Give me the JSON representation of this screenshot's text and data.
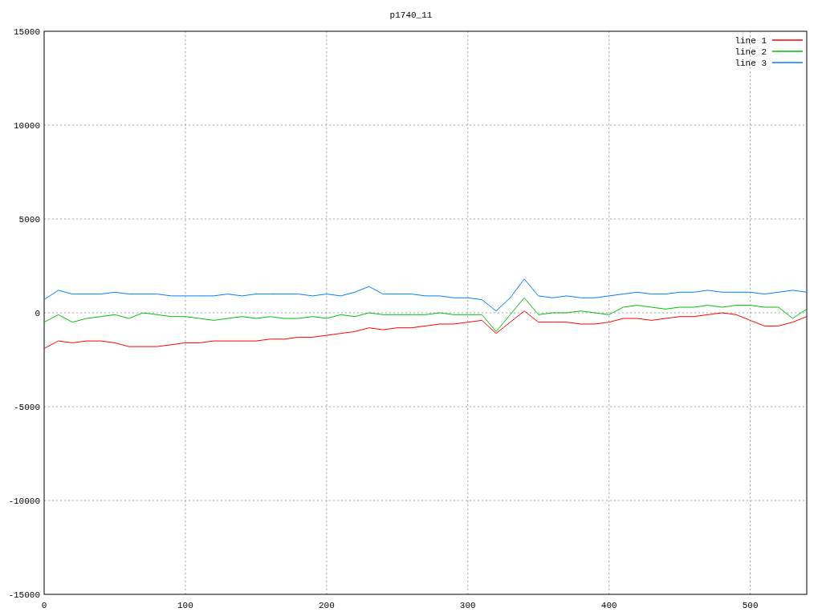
{
  "chart_data": {
    "type": "line",
    "title": "p1740_11",
    "x": [
      0,
      10,
      20,
      30,
      40,
      50,
      60,
      70,
      80,
      90,
      100,
      110,
      120,
      130,
      140,
      150,
      160,
      170,
      180,
      190,
      200,
      210,
      220,
      230,
      240,
      250,
      260,
      270,
      280,
      290,
      300,
      310,
      320,
      330,
      340,
      350,
      360,
      370,
      380,
      390,
      400,
      410,
      420,
      430,
      440,
      450,
      460,
      470,
      480,
      490,
      500,
      510,
      520,
      530,
      540
    ],
    "series": [
      {
        "name": "line 1",
        "color": "#ff0000",
        "values": [
          -1900,
          -1500,
          -1600,
          -1500,
          -1500,
          -1600,
          -1800,
          -1800,
          -1800,
          -1700,
          -1600,
          -1600,
          -1500,
          -1500,
          -1500,
          -1500,
          -1400,
          -1400,
          -1300,
          -1300,
          -1200,
          -1100,
          -1000,
          -800,
          -900,
          -800,
          -800,
          -700,
          -600,
          -600,
          -500,
          -400,
          -1100,
          -500,
          100,
          -500,
          -500,
          -500,
          -600,
          -600,
          -500,
          -300,
          -300,
          -400,
          -300,
          -200,
          -200,
          -100,
          0,
          -100,
          -400,
          -700,
          -700,
          -500,
          -200
        ]
      },
      {
        "name": "line 2",
        "color": "#00c000",
        "values": [
          -500,
          -100,
          -500,
          -300,
          -200,
          -100,
          -300,
          0,
          -100,
          -200,
          -200,
          -300,
          -400,
          -300,
          -200,
          -300,
          -200,
          -300,
          -300,
          -200,
          -300,
          -100,
          -200,
          0,
          -100,
          -100,
          -100,
          -100,
          0,
          -100,
          -100,
          -100,
          -1000,
          -100,
          800,
          -100,
          0,
          0,
          100,
          0,
          -100,
          300,
          400,
          300,
          200,
          300,
          300,
          400,
          300,
          400,
          400,
          300,
          300,
          -300,
          200
        ]
      },
      {
        "name": "line 3",
        "color": "#0080ff",
        "values": [
          700,
          1200,
          1000,
          1000,
          1000,
          1100,
          1000,
          1000,
          1000,
          900,
          900,
          900,
          900,
          1000,
          900,
          1000,
          1000,
          1000,
          1000,
          900,
          1000,
          900,
          1100,
          1400,
          1000,
          1000,
          1000,
          900,
          900,
          800,
          800,
          700,
          100,
          800,
          1800,
          900,
          800,
          900,
          800,
          800,
          900,
          1000,
          1100,
          1000,
          1000,
          1100,
          1100,
          1200,
          1100,
          1100,
          1100,
          1000,
          1100,
          1200,
          1100
        ]
      }
    ],
    "xlim": [
      0,
      540
    ],
    "ylim": [
      -15000,
      15000
    ],
    "xticks": [
      0,
      100,
      200,
      300,
      400,
      500
    ],
    "yticks": [
      -15000,
      -10000,
      -5000,
      0,
      5000,
      10000,
      15000
    ],
    "grid": true,
    "legend": true
  }
}
